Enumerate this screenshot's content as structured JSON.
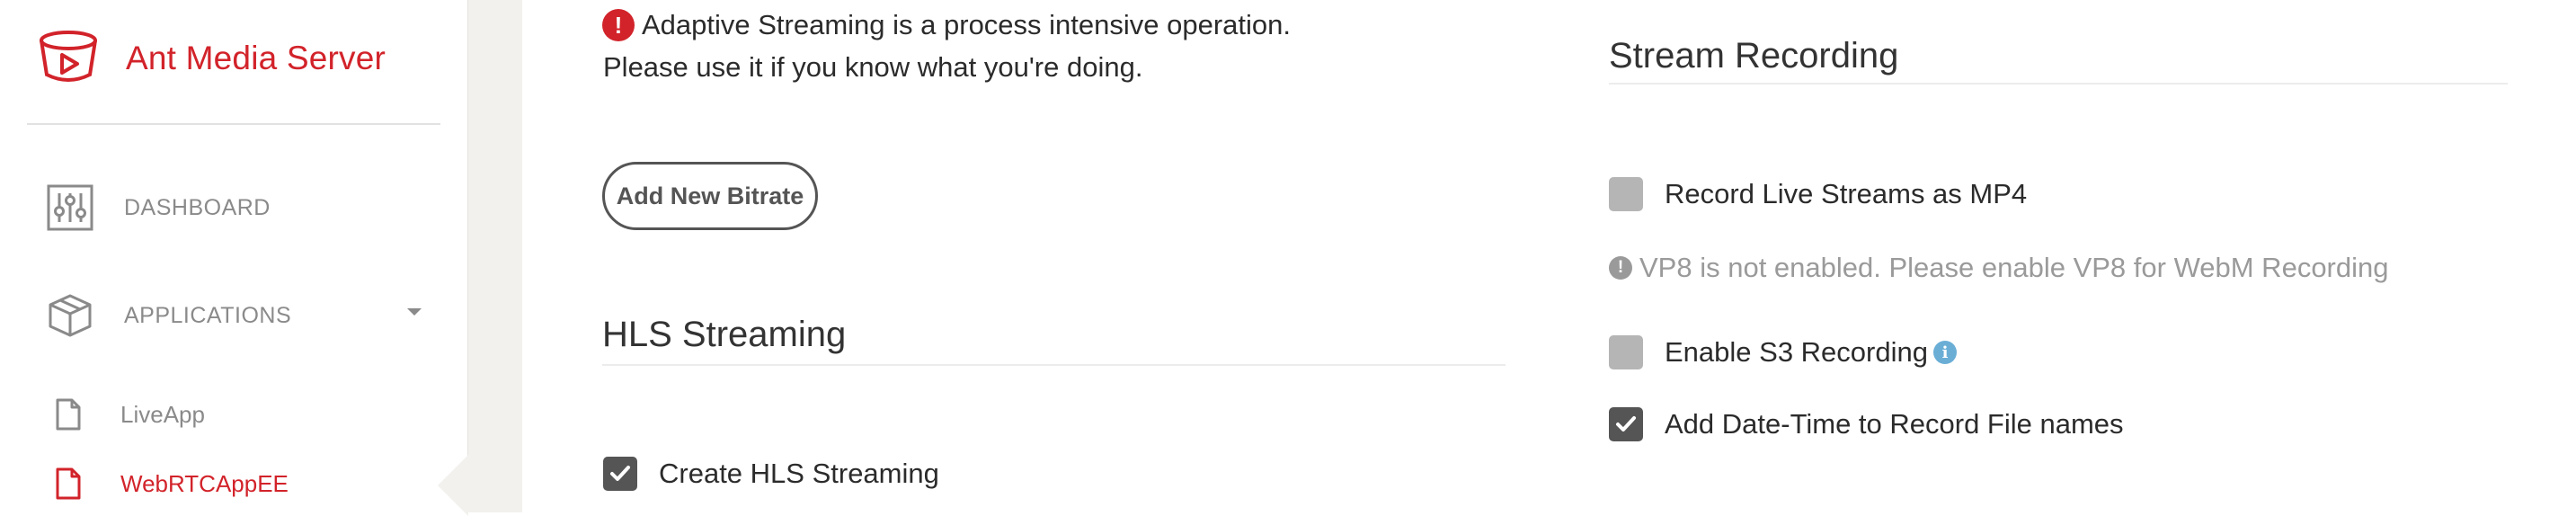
{
  "brand": {
    "name": "Ant Media Server",
    "logo_icon": "ant-media-logo-icon",
    "color": "#d2232a"
  },
  "sidebar": {
    "items": [
      {
        "label": "DASHBOARD",
        "icon": "sliders-icon"
      },
      {
        "label": "APPLICATIONS",
        "icon": "cube-icon",
        "expandable": true
      }
    ],
    "apps": [
      {
        "label": "LiveApp",
        "icon": "file-icon",
        "active": false
      },
      {
        "label": "WebRTCAppEE",
        "icon": "file-icon",
        "active": true
      }
    ]
  },
  "adaptive": {
    "warning_line1": "Adaptive Streaming is a process intensive operation.",
    "warning_line2": "Please use it if you know what you're doing.",
    "warning_icon": "exclamation-circle-icon",
    "add_bitrate_label": "Add New Bitrate"
  },
  "hls": {
    "title": "HLS Streaming",
    "create_label": "Create HLS Streaming",
    "create_checked": true
  },
  "recording": {
    "title": "Stream Recording",
    "mp4_label": "Record Live Streams as MP4",
    "mp4_checked": false,
    "vp8_note": "VP8 is not enabled. Please enable VP8 for WebM Recording",
    "s3_label": "Enable S3 Recording",
    "s3_checked": false,
    "s3_info_icon": "info-icon",
    "datetime_label": "Add Date-Time to Record File names",
    "datetime_checked": true
  }
}
